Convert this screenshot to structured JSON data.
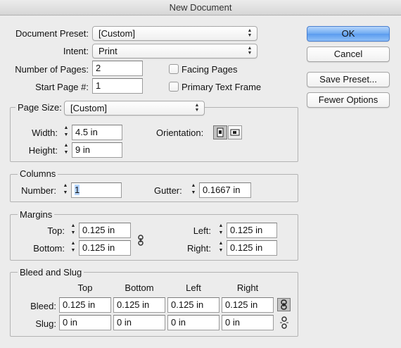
{
  "window": {
    "title": "New Document"
  },
  "document_preset": {
    "label": "Document Preset:",
    "value": "[Custom]"
  },
  "intent": {
    "label": "Intent:",
    "value": "Print"
  },
  "number_of_pages": {
    "label": "Number of Pages:",
    "value": "2"
  },
  "start_page": {
    "label": "Start Page #:",
    "value": "1"
  },
  "facing_pages": {
    "label": "Facing Pages",
    "checked": false
  },
  "primary_text_frame": {
    "label": "Primary Text Frame",
    "checked": false
  },
  "buttons": {
    "ok": "OK",
    "cancel": "Cancel",
    "save_preset": "Save Preset...",
    "fewer_options": "Fewer Options"
  },
  "page_size": {
    "legend": "Page Size:",
    "value": "[Custom]",
    "width_label": "Width:",
    "width": "4.5 in",
    "height_label": "Height:",
    "height": "9 in",
    "orientation_label": "Orientation:",
    "orientation_selected": "portrait"
  },
  "columns": {
    "legend": "Columns",
    "number_label": "Number:",
    "number": "1",
    "gutter_label": "Gutter:",
    "gutter": "0.1667 in"
  },
  "margins": {
    "legend": "Margins",
    "top_label": "Top:",
    "top": "0.125 in",
    "bottom_label": "Bottom:",
    "bottom": "0.125 in",
    "left_label": "Left:",
    "left": "0.125 in",
    "right_label": "Right:",
    "right": "0.125 in"
  },
  "bleed_slug": {
    "legend": "Bleed and Slug",
    "col_top": "Top",
    "col_bottom": "Bottom",
    "col_left": "Left",
    "col_right": "Right",
    "bleed_label": "Bleed:",
    "bleed": [
      "0.125 in",
      "0.125 in",
      "0.125 in",
      "0.125 in"
    ],
    "slug_label": "Slug:",
    "slug": [
      "0 in",
      "0 in",
      "0 in",
      "0 in"
    ]
  },
  "icons": {
    "stepper": "stepper-arrows-icon",
    "popup": "popup-arrows-icon",
    "chain_linked": "chain-link-icon",
    "chain_broken": "chain-unlink-icon",
    "portrait": "portrait-orientation-icon",
    "landscape": "landscape-orientation-icon"
  }
}
